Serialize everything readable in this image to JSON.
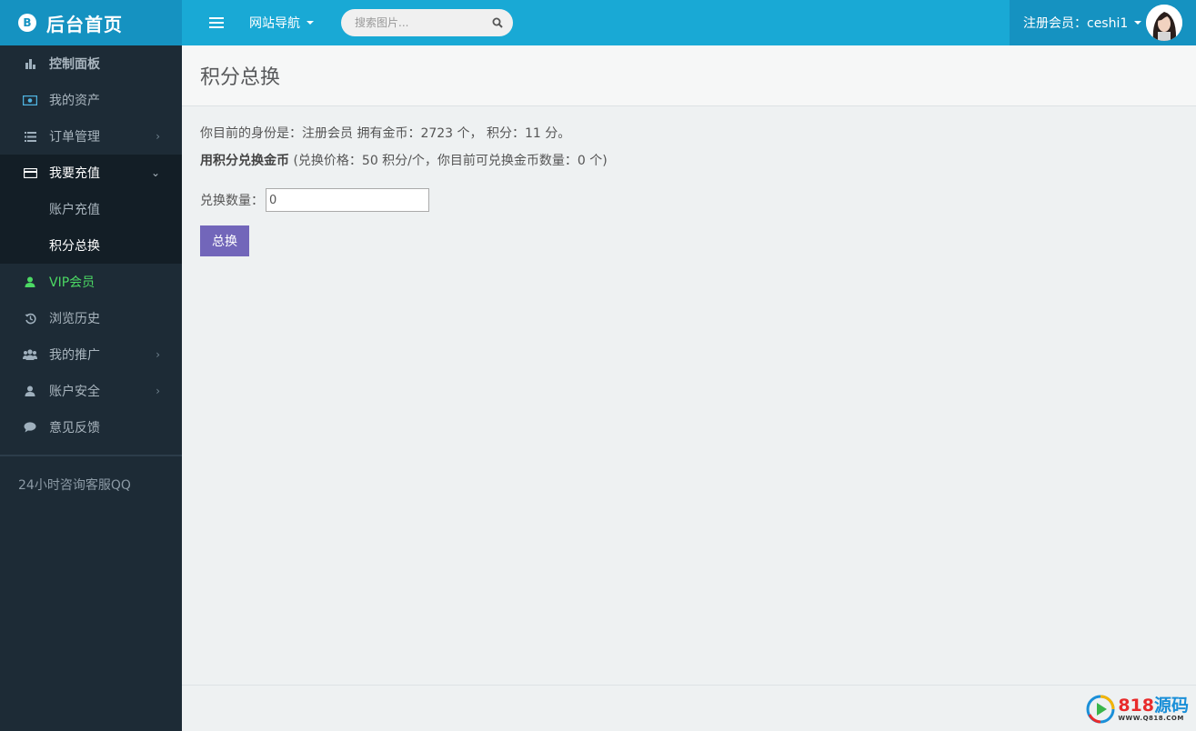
{
  "brand": {
    "icon": "B",
    "title": "后台首页"
  },
  "sidebar": {
    "items": [
      {
        "label": "控制面板",
        "icon": "bar-chart-icon"
      },
      {
        "label": "我的资产",
        "icon": "money-icon"
      },
      {
        "label": "订单管理",
        "icon": "list-icon"
      },
      {
        "label": "我要充值",
        "icon": "credit-card-icon"
      },
      {
        "label": "VIP会员",
        "icon": "user-icon"
      },
      {
        "label": "浏览历史",
        "icon": "history-icon"
      },
      {
        "label": "我的推广",
        "icon": "users-icon"
      },
      {
        "label": "账户安全",
        "icon": "user-icon"
      },
      {
        "label": "意见反馈",
        "icon": "comment-icon"
      }
    ],
    "submenu": [
      {
        "label": "账户充值"
      },
      {
        "label": "积分总换"
      }
    ],
    "footer_text": "24小时咨询客服QQ"
  },
  "topbar": {
    "nav_label": "网站导航",
    "search_placeholder": "搜索图片...",
    "user_label": "注册会员：ceshi1"
  },
  "page": {
    "title": "积分总换",
    "identity_line": "你目前的身份是：注册会员 拥有金币：2723 个， 积分：11 分。",
    "exchange_title": "用积分兑换金币",
    "exchange_detail": "(兑换价格：50 积分/个，你目前可兑换金币数量：0 个)",
    "quantity_label": "兑换数量：",
    "quantity_value": "0",
    "submit_label": "总换"
  },
  "watermark": {
    "main_num": "818",
    "main_cn": "源码",
    "sub": "WWW.Q818.COM"
  },
  "colors": {
    "sidebar_bg": "#1d2b36",
    "topbar_bg": "#19a9d5",
    "brand_bg": "#1592c1",
    "button_bg": "#7266ba",
    "vip_green": "#4cd964"
  }
}
